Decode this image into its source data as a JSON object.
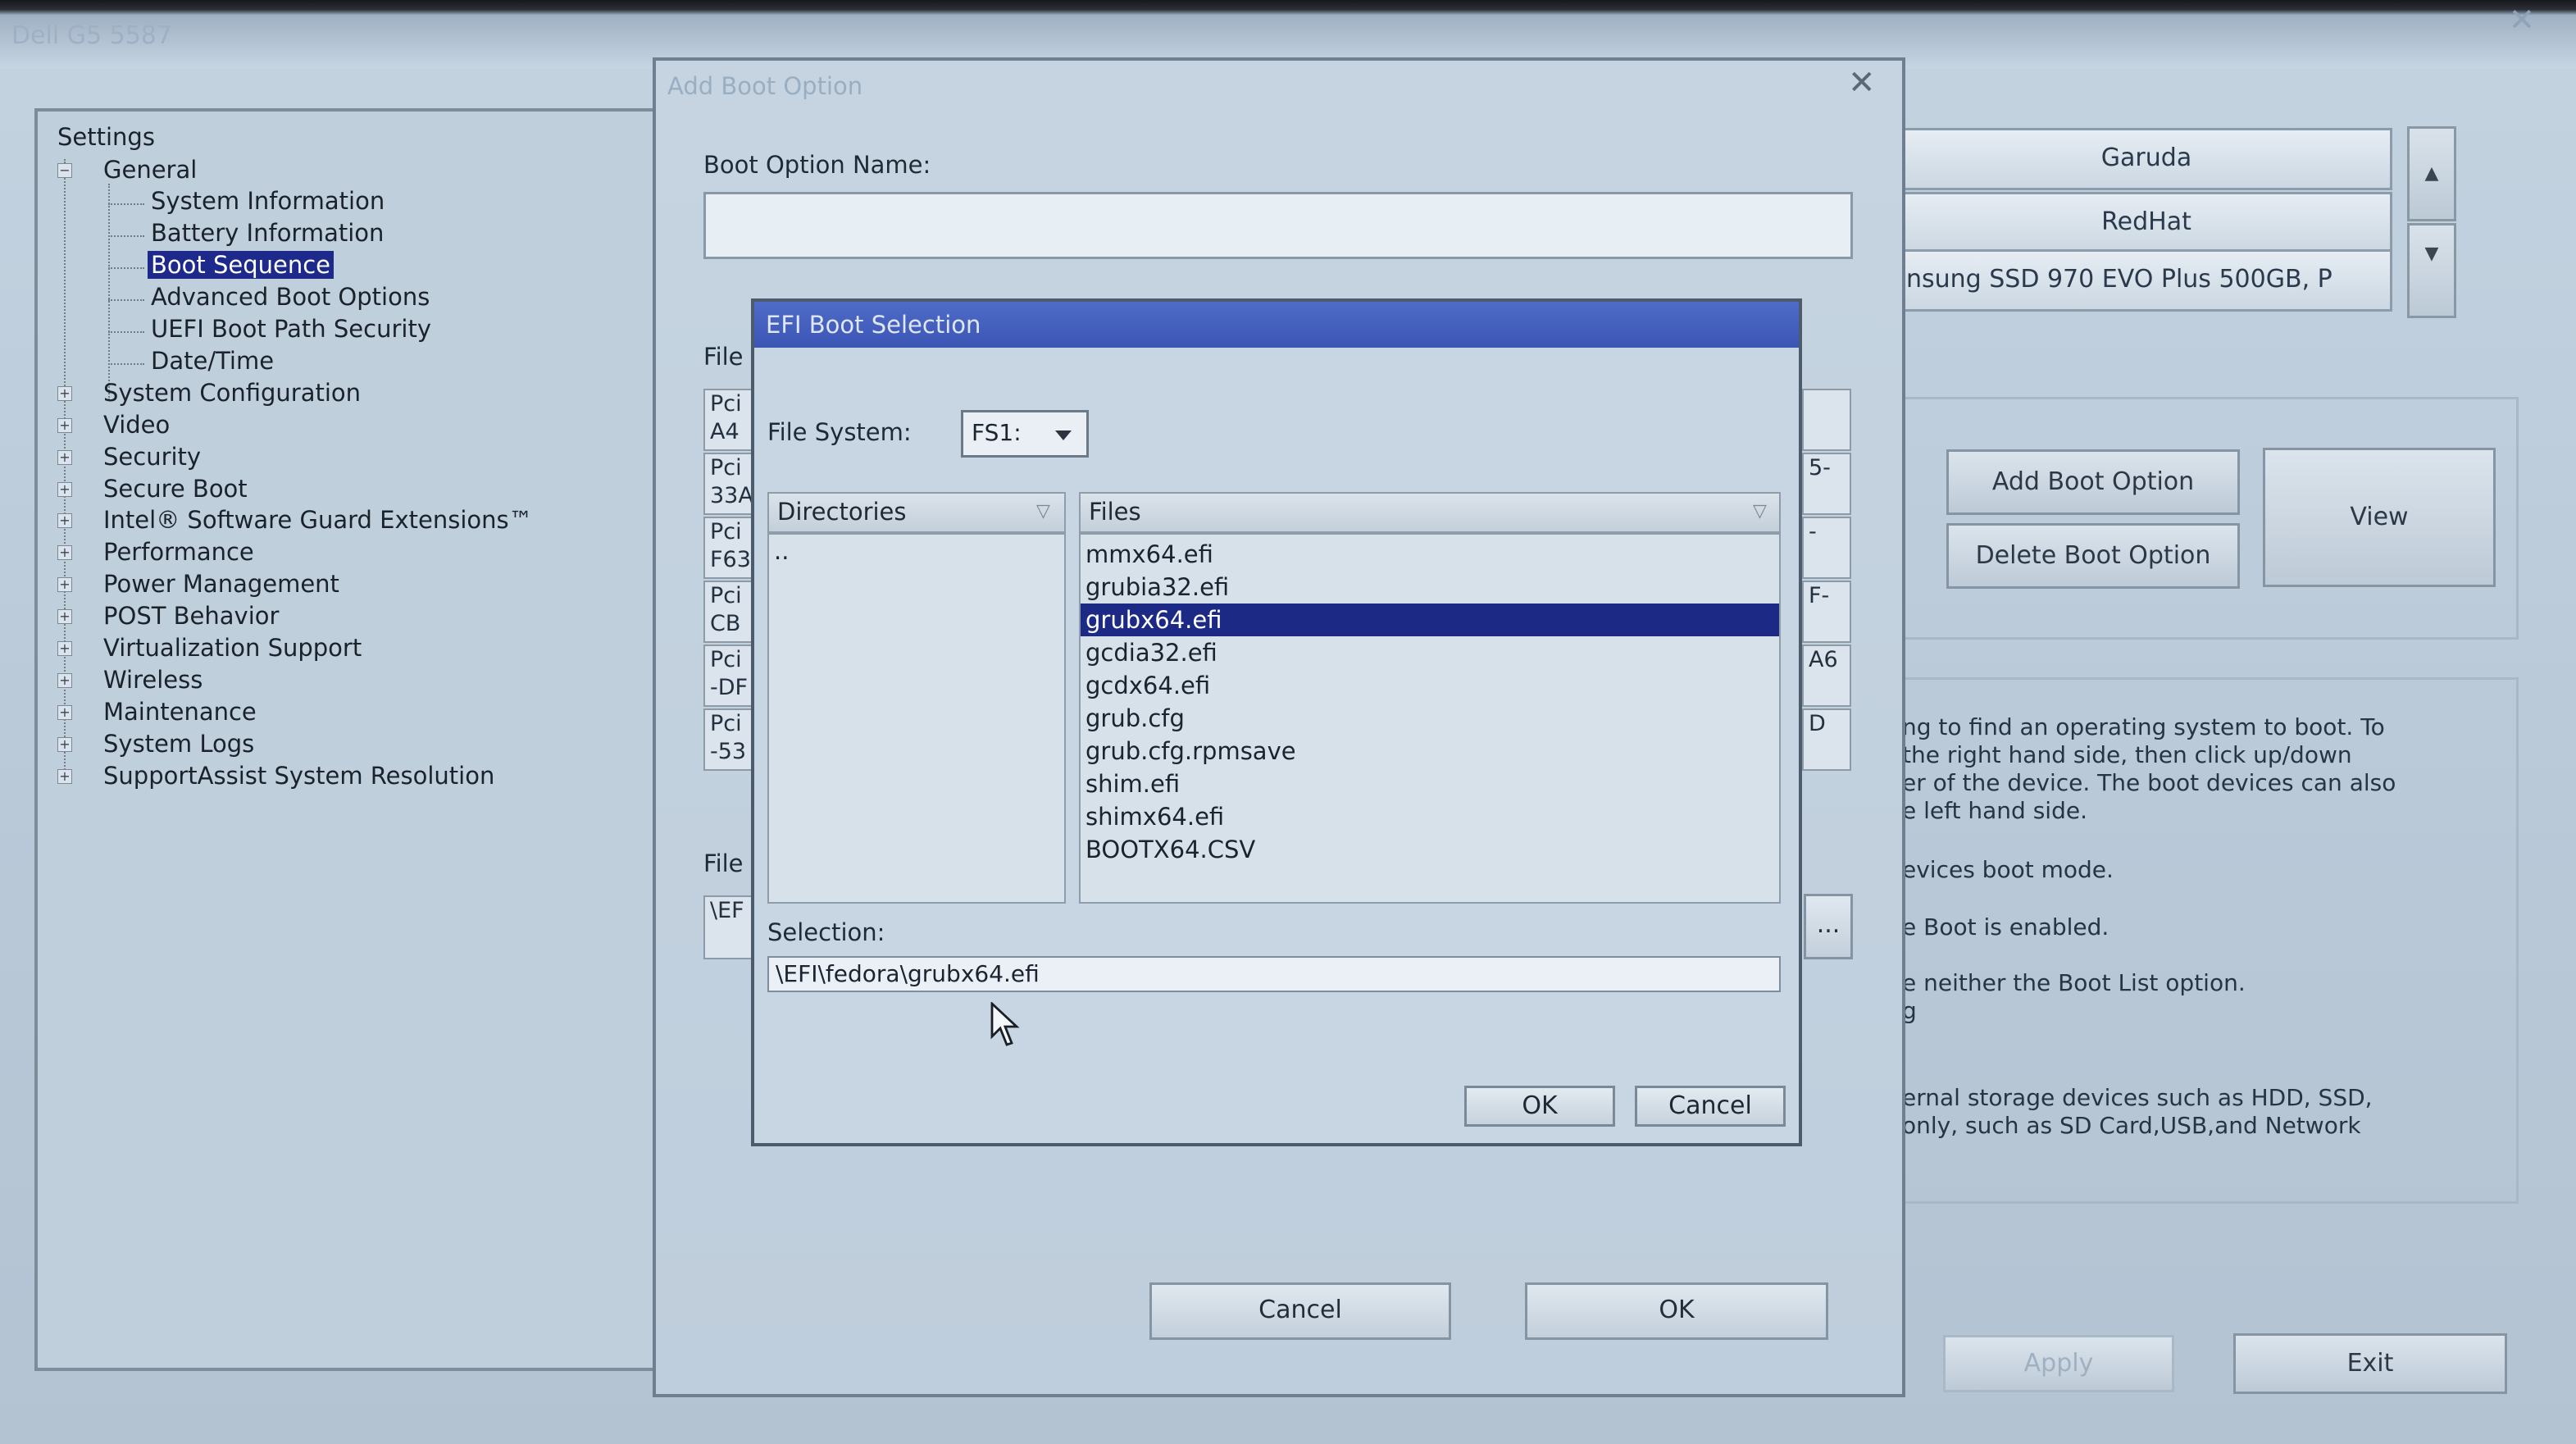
{
  "window": {
    "title": "Dell G5 5587"
  },
  "settings_tree": {
    "root": "Settings",
    "items": [
      {
        "label": "General",
        "level": 0,
        "expanded": true
      },
      {
        "label": "System Information",
        "level": 1
      },
      {
        "label": "Battery Information",
        "level": 1
      },
      {
        "label": "Boot Sequence",
        "level": 1,
        "selected": true
      },
      {
        "label": "Advanced Boot Options",
        "level": 1
      },
      {
        "label": "UEFI Boot Path Security",
        "level": 1
      },
      {
        "label": "Date/Time",
        "level": 1
      },
      {
        "label": "System Configuration",
        "level": 0
      },
      {
        "label": "Video",
        "level": 0
      },
      {
        "label": "Security",
        "level": 0
      },
      {
        "label": "Secure Boot",
        "level": 0
      },
      {
        "label": "Intel® Software Guard Extensions™",
        "level": 0
      },
      {
        "label": "Performance",
        "level": 0
      },
      {
        "label": "Power Management",
        "level": 0
      },
      {
        "label": "POST Behavior",
        "level": 0
      },
      {
        "label": "Virtualization Support",
        "level": 0
      },
      {
        "label": "Wireless",
        "level": 0
      },
      {
        "label": "Maintenance",
        "level": 0
      },
      {
        "label": "System Logs",
        "level": 0
      },
      {
        "label": "SupportAssist System Resolution",
        "level": 0
      }
    ]
  },
  "boot_list": {
    "items": [
      "Garuda",
      "RedHat",
      "nsung SSD 970 EVO Plus 500GB, P"
    ]
  },
  "boot_buttons": {
    "add": "Add Boot Option",
    "delete": "Delete Boot Option",
    "view": "View"
  },
  "description_lines": [
    "ng to find an operating system to boot. To",
    "the right hand side, then click up/down",
    "er of the device. The boot devices can also",
    "e left hand side.",
    "evices boot mode.",
    "e Boot is enabled.",
    "e neither the Boot List option.",
    "g",
    "ernal storage devices such as HDD, SSD,",
    "only, such as SD Card,USB,and Network"
  ],
  "footer": {
    "apply": "Apply",
    "exit": "Exit"
  },
  "add_boot_option": {
    "title": "Add Boot Option",
    "name_label": "Boot Option Name:",
    "name_value": "",
    "file_system_label": "File",
    "file_system_stubs": [
      "Pci\nA4",
      "Pci\n33A",
      "Pci\nF63",
      "Pci\nCB",
      "Pci\n-DF",
      "Pci\n-53"
    ],
    "file_system_stubs_right": [
      "",
      "5-",
      "-",
      "F-",
      "A6",
      "D"
    ],
    "file_name_label": "File",
    "file_name_value": "\\EF",
    "browse": "...",
    "cancel": "Cancel",
    "ok": "OK"
  },
  "efi_dialog": {
    "title": "EFI Boot Selection",
    "file_system_label": "File System:",
    "file_system_value": "FS1:",
    "directories_header": "Directories",
    "directories": [
      ".."
    ],
    "files_header": "Files",
    "files": [
      "mmx64.efi",
      "grubia32.efi",
      "grubx64.efi",
      "gcdia32.efi",
      "gcdx64.efi",
      "grub.cfg",
      "grub.cfg.rpmsave",
      "shim.efi",
      "shimx64.efi",
      "BOOTX64.CSV"
    ],
    "selected_file": "grubx64.efi",
    "selection_label": "Selection:",
    "selection_value": "\\EFI\\fedora\\grubx64.efi",
    "ok": "OK",
    "cancel": "Cancel"
  }
}
